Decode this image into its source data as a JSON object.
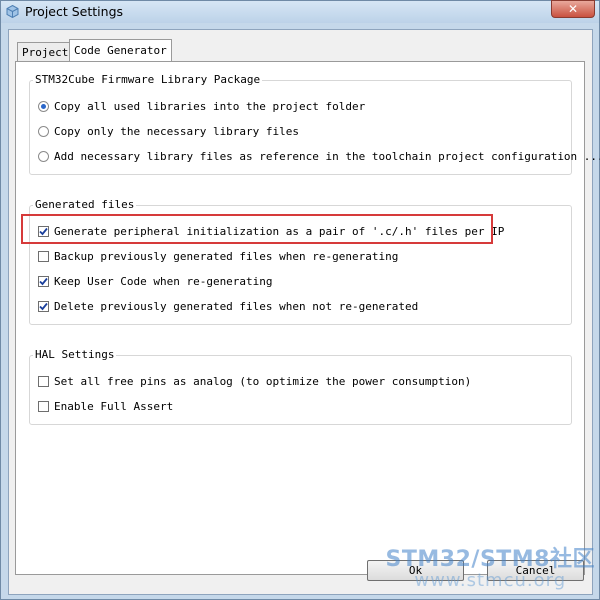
{
  "window": {
    "title": "Project Settings",
    "close_glyph": "✕"
  },
  "tabs": [
    {
      "label": "Project",
      "active": false
    },
    {
      "label": "Code Generator",
      "active": true
    }
  ],
  "firmware_group": {
    "title": "STM32Cube Firmware Library Package",
    "options": [
      {
        "label": "Copy all used libraries into the project folder",
        "selected": true
      },
      {
        "label": "Copy only the necessary library files",
        "selected": false
      },
      {
        "label": "Add necessary library files as reference in the toolchain project configuration ...",
        "selected": false
      }
    ]
  },
  "generated_files_group": {
    "title": "Generated files",
    "options": [
      {
        "label": "Generate peripheral initialization as a pair of '.c/.h' files per IP",
        "checked": true
      },
      {
        "label": "Backup previously generated files when re-generating",
        "checked": false
      },
      {
        "label": "Keep User Code when re-generating",
        "checked": true
      },
      {
        "label": "Delete previously generated files when not re-generated",
        "checked": true
      }
    ]
  },
  "hal_group": {
    "title": "HAL Settings",
    "options": [
      {
        "label": "Set all free pins as analog (to optimize the power consumption)",
        "checked": false
      },
      {
        "label": "Enable Full Assert",
        "checked": false
      }
    ]
  },
  "buttons": {
    "ok": "Ok",
    "cancel": "Cancel"
  },
  "watermark": {
    "title": "STM32/STM8社区",
    "url": "www.stmcu.org"
  },
  "colors": {
    "highlight": "#d63a3a",
    "accent": "#2a66c9"
  }
}
